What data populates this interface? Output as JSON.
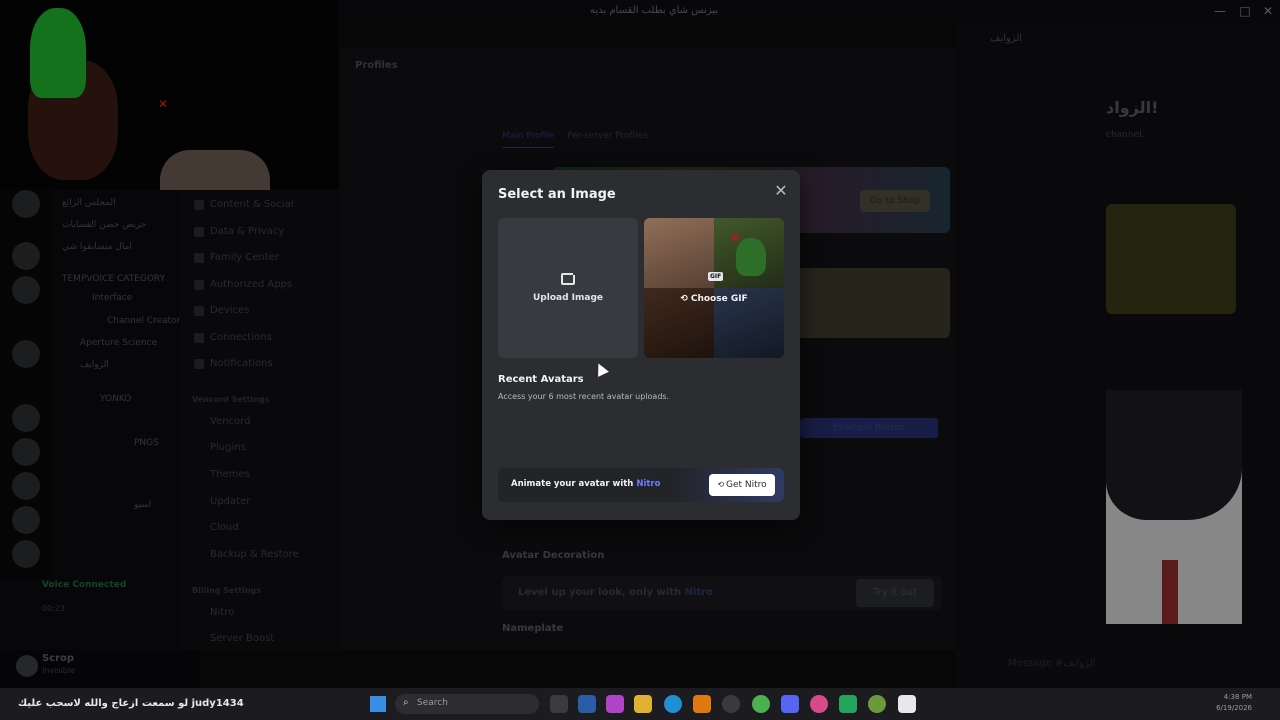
{
  "window": {
    "title": "بيزنس شاي بطلب القسام بديه",
    "controls": {
      "minimize": "—",
      "maximize": "□",
      "close": "✕"
    }
  },
  "channels": {
    "rows": [
      "المجلس الرائع",
      "حريص حصن القسايات",
      "امأل متسابقوا شي",
      "TEMPVOICE CATEGORY",
      "Interface",
      "Channel Creator",
      "Aperture Science",
      "الزوايف",
      "YONKO",
      "PNGS",
      "اسيو"
    ],
    "voice_connected": "Voice Connected",
    "voice_time": "00:23"
  },
  "user": {
    "name": "Scrop",
    "status": "Invisible"
  },
  "settings_nav": {
    "items": [
      "Content & Social",
      "Data & Privacy",
      "Family Center",
      "Authorized Apps",
      "Devices",
      "Connections",
      "Notifications"
    ],
    "vencord_header": "Vencord Settings",
    "vencord_items": [
      "Vencord",
      "Plugins",
      "Themes",
      "Updater",
      "Cloud",
      "Backup & Restore"
    ],
    "billing_header": "Billing Settings",
    "billing_items": [
      "Nitro",
      "Server Boost"
    ]
  },
  "profiles": {
    "header": "Profiles",
    "tabs": [
      "Main Profile",
      "Per-server Profiles"
    ],
    "go_to_shop": "Go to Shop",
    "example_button": "Example Button",
    "avatar_decoration": "Avatar Decoration",
    "level_up": "Level up your look, only with",
    "level_up_nitro": "Nitro",
    "try_it_out": "Try it out",
    "nameplate": "Nameplate"
  },
  "right_panel": {
    "header": "الزوايف",
    "title": "الزواد!",
    "subtitle": "channel."
  },
  "message_placeholder": "Message #الزوايف",
  "modal": {
    "title": "Select an Image",
    "upload_label": "Upload Image",
    "choose_gif_label": "Choose GIF",
    "gif_tag": "GIF",
    "recent_title": "Recent Avatars",
    "recent_desc": "Access your 6 most recent avatar uploads.",
    "promo_text": "Animate your avatar with",
    "promo_nitro": "Nitro",
    "get_nitro": "Get Nitro"
  },
  "taskbar": {
    "ticker": "لو سمعت ازعاج والله لاسحب عليك  judy1434",
    "search_placeholder": "Search",
    "time": "4:38 PM",
    "date": "6/19/2026"
  },
  "colors": {
    "accent": "#5865f2",
    "nitro": "#6e7dff",
    "modal_bg": "#2b2d31"
  }
}
